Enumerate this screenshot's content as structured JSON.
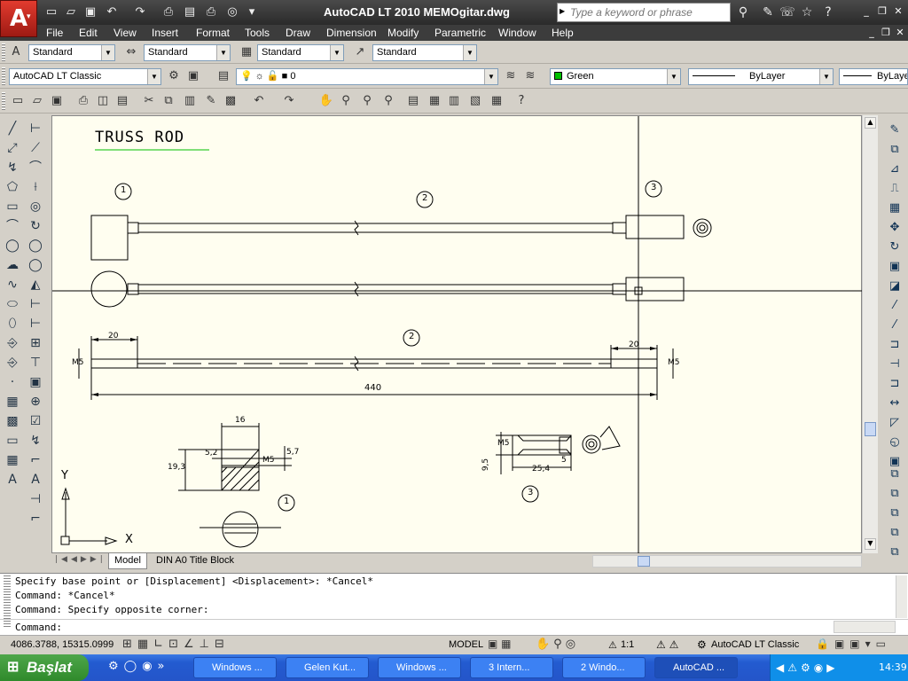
{
  "title_bar": {
    "title": "AutoCAD LT 2010    MEMOgitar.dwg",
    "search_placeholder": "Type a keyword or phrase"
  },
  "menu": [
    "File",
    "Edit",
    "View",
    "Insert",
    "Format",
    "Tools",
    "Draw",
    "Dimension",
    "Modify",
    "Parametric",
    "Window",
    "Help"
  ],
  "styles_toolbar": {
    "text_style": "Standard",
    "dim_style": "Standard",
    "table_style": "Standard",
    "mleader_style": "Standard"
  },
  "workspace_toolbar": {
    "workspace": "AutoCAD LT Classic",
    "layer": "0",
    "color": "Green",
    "linetype": "ByLayer",
    "lineweight": "ByLayer"
  },
  "drawing": {
    "title": "TRUSS ROD",
    "balloons": [
      "1",
      "2",
      "3",
      "2",
      "1",
      "3"
    ],
    "dims": {
      "rod_length": "440",
      "left_thread_len": "20",
      "right_thread_len": "20",
      "thread_left": "M5",
      "thread_right": "M5",
      "block_width": "16",
      "block_height": "19,3",
      "block_hole_offset": "5,2",
      "block_thread": "M5",
      "block_hole_right": "5,7",
      "nut_thread": "M5",
      "nut_dia": "9,5",
      "nut_len": "25,4",
      "nut_hex": "5"
    },
    "ucs": {
      "y_label": "Y",
      "x_label": "X"
    }
  },
  "layout_tabs": [
    "Model",
    "DIN A0 Title Block"
  ],
  "command_history": [
    "Specify base point or [Displacement] <Displacement>: *Cancel*",
    "Command: *Cancel*",
    "Command: Specify opposite corner:"
  ],
  "command_prompt": "Command:",
  "status": {
    "coordinates": "4086.3788, 15315.0999",
    "model_label": "MODEL",
    "annotation_scale": "1:1",
    "workspace": "AutoCAD LT Classic"
  },
  "taskbar": {
    "start_label": "Başlat",
    "items": [
      "Windows ...",
      "Gelen Kut...",
      "Windows ...",
      "3 Intern...",
      "2 Windo...",
      "AutoCAD ..."
    ],
    "clock": "14:39"
  },
  "colors": {
    "canvas_bg": "#fffef0",
    "title_bar": "#3a3a3a",
    "taskbar": "#245edb",
    "start_button": "#3c9a37",
    "layer_green": "#00c000"
  }
}
